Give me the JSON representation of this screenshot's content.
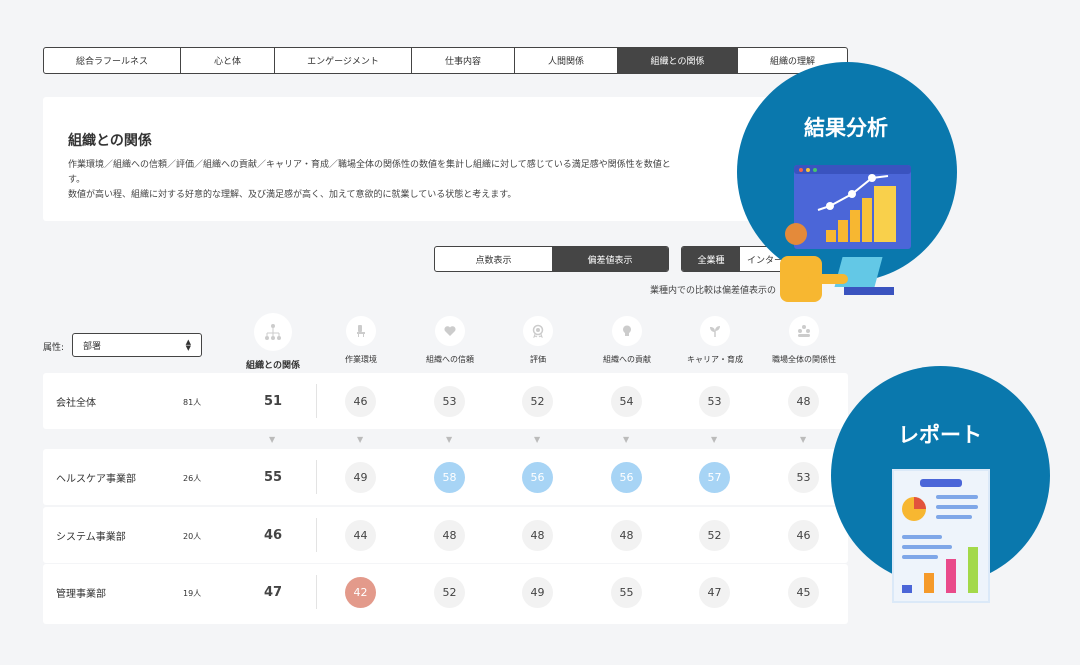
{
  "tabs": [
    {
      "label": "総合ラフールネス",
      "active": false
    },
    {
      "label": "心と体",
      "active": false
    },
    {
      "label": "エンゲージメント",
      "active": false
    },
    {
      "label": "仕事内容",
      "active": false
    },
    {
      "label": "人間関係",
      "active": false
    },
    {
      "label": "組織との関係",
      "active": true
    },
    {
      "label": "組織の理解",
      "active": false
    }
  ],
  "description": {
    "title": "組織との関係",
    "line1": "作業環境／組織への信頼／評価／組織への貢献／キャリア・育成／職場全体の関係性の数値を集計し組織に対して感じている満足感や関係性を数値と",
    "line2": "す。",
    "line3": "数値が高い程、組織に対する好意的な理解、及び満足感が高く、加えて意欲的に就業している状態と考えます。"
  },
  "display_toggle": {
    "score": "点数表示",
    "deviation": "偏差値表示"
  },
  "industry_toggle": {
    "all": "全業種",
    "other": "インター"
  },
  "note": "業種内での比較は偏差値表示の",
  "attribute": {
    "label": "属性:",
    "value": "部署"
  },
  "columns": {
    "main": "組織との関係",
    "items": [
      "作業環境",
      "組織への信頼",
      "評価",
      "組織への貢献",
      "キャリア・育成",
      "職場全体の関係性"
    ]
  },
  "rows": [
    {
      "name": "会社全体",
      "count": "81人",
      "main": "51",
      "values": [
        "46",
        "53",
        "52",
        "54",
        "53",
        "48"
      ],
      "states": [
        "n",
        "n",
        "n",
        "n",
        "n",
        "n"
      ]
    },
    {
      "name": "ヘルスケア事業部",
      "count": "26人",
      "main": "55",
      "values": [
        "49",
        "58",
        "56",
        "56",
        "57",
        "53"
      ],
      "states": [
        "n",
        "hi",
        "hi",
        "hi",
        "hi",
        "n"
      ]
    },
    {
      "name": "システム事業部",
      "count": "20人",
      "main": "46",
      "values": [
        "44",
        "48",
        "48",
        "48",
        "52",
        "46"
      ],
      "states": [
        "n",
        "n",
        "n",
        "n",
        "n",
        "n"
      ]
    },
    {
      "name": "管理事業部",
      "count": "19人",
      "main": "47",
      "values": [
        "42",
        "52",
        "49",
        "55",
        "47",
        "45"
      ],
      "states": [
        "lo",
        "n",
        "n",
        "n",
        "n",
        "n"
      ]
    }
  ],
  "overlays": {
    "analysis": "結果分析",
    "report": "レポート"
  },
  "colors": {
    "accent": "#0a78ad",
    "high": "#a7d4f5",
    "low": "#e39a8b",
    "active_tab": "#454545"
  },
  "icons": {
    "main": "org-chart-icon",
    "items": [
      "chair-icon",
      "heart-icon",
      "badge-icon",
      "lightbulb-icon",
      "sprout-icon",
      "people-icon"
    ]
  }
}
